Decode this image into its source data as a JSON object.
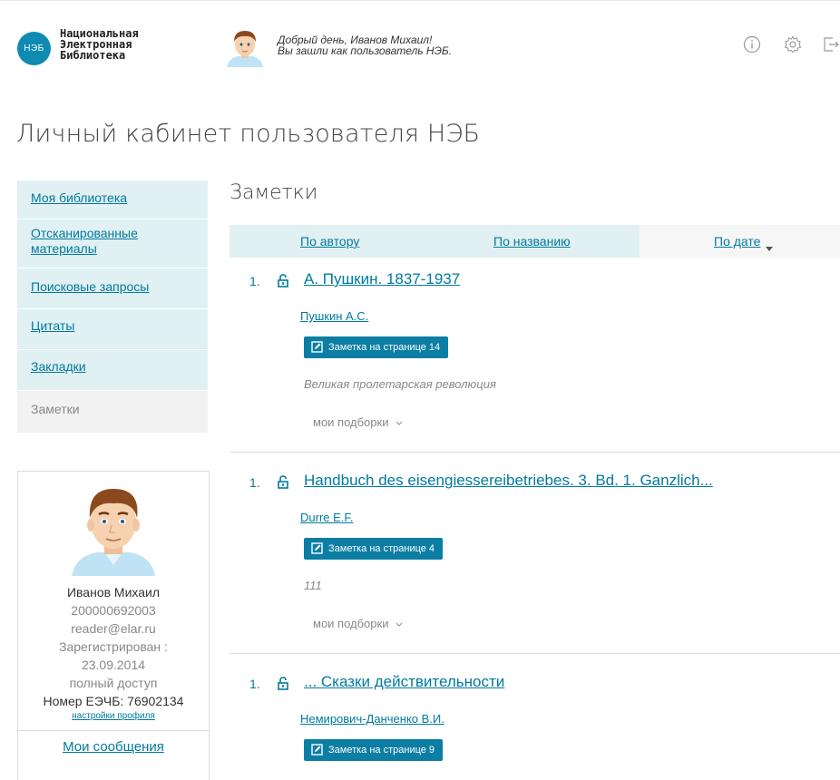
{
  "header": {
    "logo_abbr": "НЭБ",
    "logo_lines": [
      "Национальная",
      "Электронная",
      "Библиотека"
    ],
    "greeting_line1": "Добрый день, Иванов Михаил!",
    "greeting_line2": "Вы зашли как пользователь НЭБ.",
    "icons": [
      "info-icon",
      "settings-icon",
      "logout-icon"
    ]
  },
  "page_title": "Личный кабинет пользователя НЭБ",
  "sidebar": {
    "items": [
      {
        "label": "Моя библиотека",
        "active": false
      },
      {
        "label": "Отсканированные материалы",
        "active": false
      },
      {
        "label": "Поисковые запросы",
        "active": false
      },
      {
        "label": "Цитаты",
        "active": false
      },
      {
        "label": "Закладки",
        "active": false
      },
      {
        "label": "Заметки",
        "active": true
      }
    ]
  },
  "profile": {
    "name": "Иванов Михаил",
    "id": "200000692003",
    "email": "reader@elar.ru",
    "registered_label": "Зарегистрирован :",
    "registered_date": "23.09.2014",
    "access": "полный доступ",
    "card_number": "Номер ЕЭЧБ: 76902134",
    "settings_link": "настройки профиля",
    "messages_link": "Мои сообщения"
  },
  "section_title": "Заметки",
  "sort": {
    "by_author": "По автору",
    "by_title": "По названию",
    "by_date": "По дате",
    "active": "by_date"
  },
  "notes": [
    {
      "number": "1.",
      "title": "А. Пушкин. 1837-1937",
      "author": "Пушкин А.С.",
      "badge": "Заметка на странице 14",
      "quote": "Великая пролетарская революция",
      "collections": "мои подборки"
    },
    {
      "number": "1.",
      "title": "Handbuch des eisengiessereibetriebes. 3. Bd. 1. Ganzlich...",
      "author": "Durre E.F.",
      "badge": "Заметка на странице 4",
      "quote": "111",
      "collections": "мои подборки"
    },
    {
      "number": "1.",
      "title": "... Сказки действительности",
      "author": "Немирович-Данченко В.И.",
      "badge": "Заметка на странице 9",
      "quote": "",
      "collections": ""
    }
  ],
  "colors": {
    "accent": "#0c7ea4",
    "link": "#007aa0",
    "menu_bg": "#e1f0f2"
  }
}
